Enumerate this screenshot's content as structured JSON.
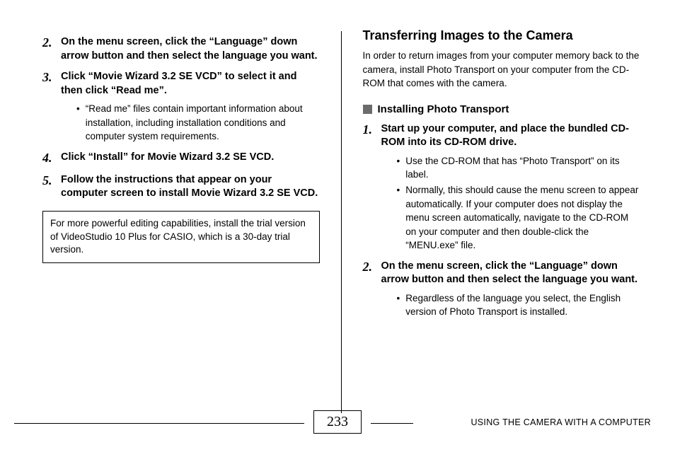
{
  "left": {
    "steps": [
      {
        "num": "2.",
        "text": "On the menu screen, click the “Language” down arrow button and then select the language you want."
      },
      {
        "num": "3.",
        "text": "Click “Movie Wizard 3.2 SE VCD” to select it and then click “Read me”.",
        "bullets": [
          "“Read me” files contain important information about installation, including installation conditions and computer system requirements."
        ]
      },
      {
        "num": "4.",
        "text": "Click “Install” for Movie Wizard 3.2 SE VCD."
      },
      {
        "num": "5.",
        "text": "Follow the instructions that appear on your computer screen to install Movie Wizard 3.2 SE VCD."
      }
    ],
    "note": "For more powerful editing capabilities, install the trial version of VideoStudio 10 Plus for CASIO, which is a 30-day trial version."
  },
  "right": {
    "title": "Transferring Images to the Camera",
    "intro": "In order to return images from your computer memory back to the camera, install Photo Transport on your computer from the CD-ROM that comes with the camera.",
    "subhead": "Installing Photo Transport",
    "steps": [
      {
        "num": "1.",
        "text": "Start up your computer, and place the bundled CD-ROM into its CD-ROM drive.",
        "bullets": [
          "Use the CD-ROM that has “Photo Transport” on its label.",
          "Normally, this should cause the menu screen to appear automatically. If your computer does not display the menu screen automatically, navigate to the CD-ROM on your computer and then double-click the “MENU.exe” file."
        ]
      },
      {
        "num": "2.",
        "text": "On the menu screen, click the “Language” down arrow button and then select the language you want.",
        "bullets": [
          "Regardless of the language you select, the English version of Photo Transport is installed."
        ]
      }
    ]
  },
  "footer": {
    "page": "233",
    "label": "USING THE CAMERA WITH A COMPUTER"
  }
}
